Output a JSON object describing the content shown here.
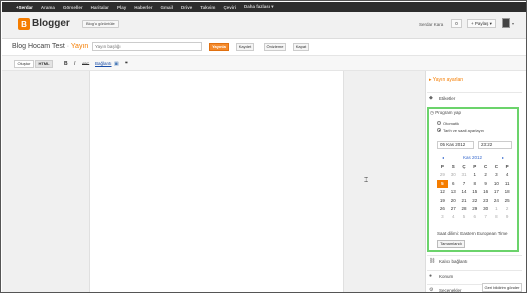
{
  "gbar": {
    "items": [
      "+Serdar",
      "Arama",
      "Görseller",
      "Haritalar",
      "Play",
      "Haberler",
      "Gmail",
      "Drive",
      "Takvim",
      "Çeviri",
      "Daha fazlası ▾"
    ]
  },
  "header": {
    "logo_letter": "B",
    "logo_text": "Blogger",
    "view_blog_label": "Blog'u görüntüle",
    "user_name": "Serdar Kara",
    "notification_count": "0",
    "share_label": "+ Paylaş",
    "share_caret": "▾",
    "avatar_caret": "▾"
  },
  "title_row": {
    "blog_name": "Blog Hocam Test",
    "separator": " · ",
    "state": "Yayın",
    "post_title_placeholder": "Yayın başlığı",
    "publish_label": "Yayınla",
    "save_label": "Kaydet",
    "preview_label": "Önizleme",
    "close_label": "Kapat"
  },
  "toolbar": {
    "compose_label": "Oluştur",
    "html_label": "HTML",
    "bold": "B",
    "italic": "I",
    "strike": "ABC",
    "link_label": "Bağlantı",
    "image_icon": "▣",
    "quote_icon": "❝"
  },
  "sidebar": {
    "heading": "▸ Yayın ayarları",
    "labels_label": "Etiketler",
    "schedule_label": "Program yap",
    "auto_label": "Otomatik",
    "manual_label": "Tarih ve saati ayarlayın",
    "date_value": "05 Kas 2012",
    "time_value": "23:22",
    "cal_prev": "◂",
    "cal_next": "▸",
    "cal_month": "Kas 2012",
    "weekday_headers": [
      "P",
      "S",
      "Ç",
      "P",
      "C",
      "C",
      "P"
    ],
    "calendar_weeks": [
      [
        {
          "d": "29",
          "dim": true
        },
        {
          "d": "30",
          "dim": true
        },
        {
          "d": "31",
          "dim": true
        },
        {
          "d": "1"
        },
        {
          "d": "2"
        },
        {
          "d": "3"
        },
        {
          "d": "4"
        }
      ],
      [
        {
          "d": "5",
          "today": true
        },
        {
          "d": "6"
        },
        {
          "d": "7"
        },
        {
          "d": "8"
        },
        {
          "d": "9"
        },
        {
          "d": "10"
        },
        {
          "d": "11"
        }
      ],
      [
        {
          "d": "12"
        },
        {
          "d": "13"
        },
        {
          "d": "14"
        },
        {
          "d": "15"
        },
        {
          "d": "16"
        },
        {
          "d": "17"
        },
        {
          "d": "18"
        }
      ],
      [
        {
          "d": "19"
        },
        {
          "d": "20"
        },
        {
          "d": "21"
        },
        {
          "d": "22"
        },
        {
          "d": "23"
        },
        {
          "d": "24"
        },
        {
          "d": "25"
        }
      ],
      [
        {
          "d": "26"
        },
        {
          "d": "27"
        },
        {
          "d": "28"
        },
        {
          "d": "29"
        },
        {
          "d": "30"
        },
        {
          "d": "1",
          "dim": true
        },
        {
          "d": "2",
          "dim": true
        }
      ],
      [
        {
          "d": "3",
          "dim": true
        },
        {
          "d": "4",
          "dim": true
        },
        {
          "d": "5",
          "dim": true
        },
        {
          "d": "6",
          "dim": true
        },
        {
          "d": "7",
          "dim": true
        },
        {
          "d": "8",
          "dim": true
        },
        {
          "d": "9",
          "dim": true
        }
      ]
    ],
    "timezone": "Saat dilimi: Eastern European Time",
    "done_label": "Tamamlandı",
    "permalink_label": "Kalıcı bağlantı",
    "location_label": "Konum",
    "options_label": "Seçenekler",
    "feedback_label": "Geri bildirim gönder"
  },
  "colors": {
    "accent": "#f57d00",
    "schedule_border": "#6bd36b",
    "gbar_bg": "#2d2d2d",
    "calendar_link": "#3366cc"
  }
}
